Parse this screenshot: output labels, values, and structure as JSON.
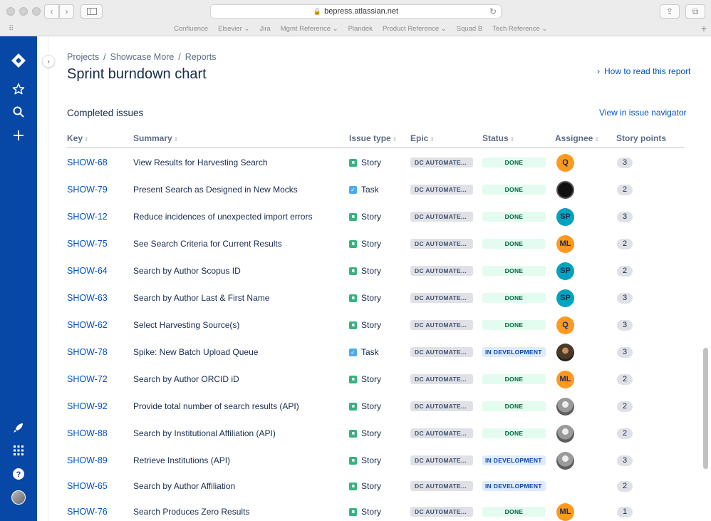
{
  "browser": {
    "url": "bepress.atlassian.net",
    "bookmarks": [
      "Confluence",
      "Elsevier ⌄",
      "Jira",
      "Mgmt Reference ⌄",
      "Plandek",
      "Product Reference ⌄",
      "Squad B",
      "Tech Reference ⌄"
    ]
  },
  "breadcrumb": [
    "Projects",
    "Showcase More",
    "Reports"
  ],
  "page_title": "Sprint burndown chart",
  "howto_label": "How to read this report",
  "section_title": "Completed issues",
  "view_nav_label": "View in issue navigator",
  "columns": {
    "key": "Key",
    "summary": "Summary",
    "issue_type": "Issue type",
    "epic": "Epic",
    "status": "Status",
    "assignee": "Assignee",
    "story_points": "Story points"
  },
  "rows": [
    {
      "key": "SHOW-68",
      "summary": "View Results for Harvesting Search",
      "type": "Story",
      "epic": "DC AUTOMATE...",
      "status": "DONE",
      "assignee": "Q",
      "avatar": "orange",
      "points": "3"
    },
    {
      "key": "SHOW-79",
      "summary": "Present Search as Designed in New Mocks",
      "type": "Task",
      "epic": "DC AUTOMATE...",
      "status": "DONE",
      "assignee": "",
      "avatar": "gauge",
      "points": "2"
    },
    {
      "key": "SHOW-12",
      "summary": "Reduce incidences of unexpected import errors",
      "type": "Story",
      "epic": "DC AUTOMATE...",
      "status": "DONE",
      "assignee": "SP",
      "avatar": "teal",
      "points": "3"
    },
    {
      "key": "SHOW-75",
      "summary": "See Search Criteria for Current Results",
      "type": "Story",
      "epic": "DC AUTOMATE...",
      "status": "DONE",
      "assignee": "ML",
      "avatar": "orange",
      "points": "2"
    },
    {
      "key": "SHOW-64",
      "summary": "Search by Author Scopus ID",
      "type": "Story",
      "epic": "DC AUTOMATE...",
      "status": "DONE",
      "assignee": "SP",
      "avatar": "teal",
      "points": "2"
    },
    {
      "key": "SHOW-63",
      "summary": "Search by Author Last & First Name",
      "type": "Story",
      "epic": "DC AUTOMATE...",
      "status": "DONE",
      "assignee": "SP",
      "avatar": "teal",
      "points": "3"
    },
    {
      "key": "SHOW-62",
      "summary": "Select Harvesting Source(s)",
      "type": "Story",
      "epic": "DC AUTOMATE...",
      "status": "DONE",
      "assignee": "Q",
      "avatar": "orange",
      "points": "3"
    },
    {
      "key": "SHOW-78",
      "summary": "Spike: New Batch Upload Queue",
      "type": "Task",
      "epic": "DC AUTOMATE...",
      "status": "IN DEVELOPMENT",
      "assignee": "",
      "avatar": "dark",
      "points": "3"
    },
    {
      "key": "SHOW-72",
      "summary": "Search by Author ORCID iD",
      "type": "Story",
      "epic": "DC AUTOMATE...",
      "status": "DONE",
      "assignee": "ML",
      "avatar": "orange",
      "points": "2"
    },
    {
      "key": "SHOW-92",
      "summary": "Provide total number of search results (API)",
      "type": "Story",
      "epic": "DC AUTOMATE...",
      "status": "DONE",
      "assignee": "",
      "avatar": "photo",
      "points": "2"
    },
    {
      "key": "SHOW-88",
      "summary": "Search by Institutional Affiliation (API)",
      "type": "Story",
      "epic": "DC AUTOMATE...",
      "status": "DONE",
      "assignee": "",
      "avatar": "photo",
      "points": "2"
    },
    {
      "key": "SHOW-89",
      "summary": "Retrieve Institutions (API)",
      "type": "Story",
      "epic": "DC AUTOMATE...",
      "status": "IN DEVELOPMENT",
      "assignee": "",
      "avatar": "photo",
      "points": "3"
    },
    {
      "key": "SHOW-65",
      "summary": "Search by Author Affiliation",
      "type": "Story",
      "epic": "DC AUTOMATE...",
      "status": "IN DEVELOPMENT",
      "assignee": "",
      "avatar": "none",
      "points": "2"
    },
    {
      "key": "SHOW-76",
      "summary": "Search Produces Zero Results",
      "type": "Story",
      "epic": "DC AUTOMATE...",
      "status": "DONE",
      "assignee": "ML",
      "avatar": "orange",
      "points": "1"
    }
  ]
}
